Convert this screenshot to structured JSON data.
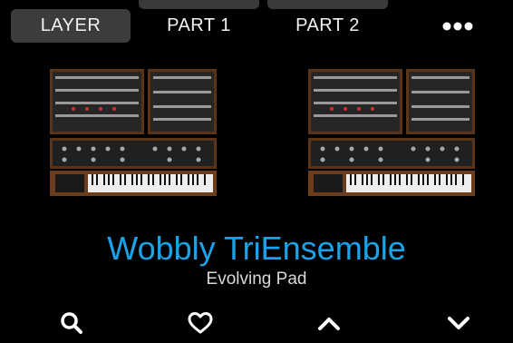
{
  "tabs": [
    {
      "label": "LAYER",
      "active": true
    },
    {
      "label": "PART 1",
      "active": false
    },
    {
      "label": "PART 2",
      "active": false
    }
  ],
  "more_icon": "more-dots-icon",
  "preset": {
    "name": "Wobbly TriEnsemble",
    "category": "Evolving Pad"
  },
  "bottom_bar": [
    "search-icon",
    "heart-icon",
    "chevron-up-icon",
    "chevron-down-icon"
  ],
  "colors": {
    "background": "#000000",
    "accent": "#1aa3e8",
    "tab_active": "#3c3c3c",
    "text": "#ffffff"
  }
}
